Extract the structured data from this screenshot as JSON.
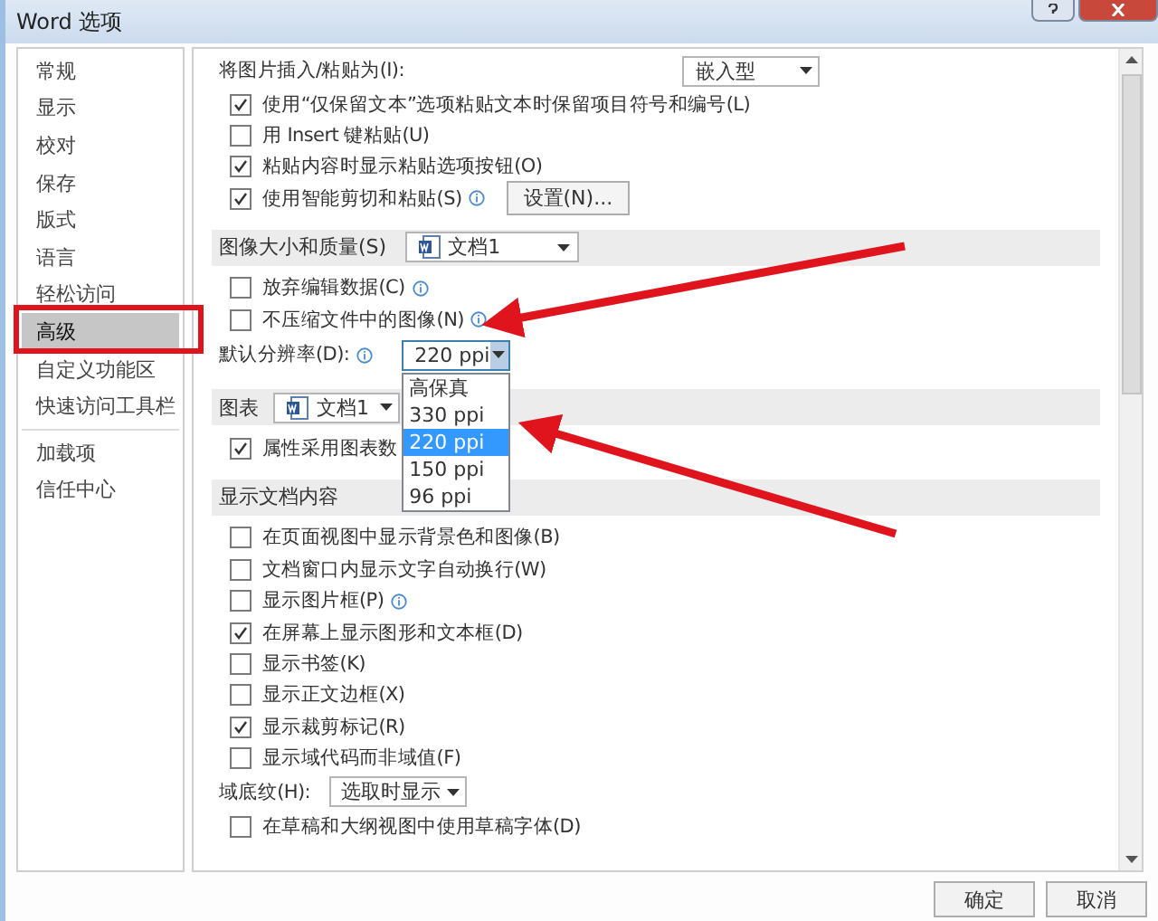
{
  "window": {
    "title": "Word 选项"
  },
  "sidebar": {
    "groups": [
      {
        "items": [
          {
            "label": "常规",
            "selected": false
          },
          {
            "label": "显示",
            "selected": false
          },
          {
            "label": "校对",
            "selected": false
          },
          {
            "label": "保存",
            "selected": false
          },
          {
            "label": "版式",
            "selected": false
          },
          {
            "label": "语言",
            "selected": false
          },
          {
            "label": "轻松访问",
            "selected": false
          },
          {
            "label": "高级",
            "selected": true
          },
          {
            "label": "自定义功能区",
            "selected": false
          },
          {
            "label": "快速访问工具栏",
            "selected": false
          }
        ]
      },
      {
        "items": [
          {
            "label": "加载项",
            "selected": false
          },
          {
            "label": "信任中心",
            "selected": false
          }
        ]
      }
    ]
  },
  "sections": [
    {
      "rows": [
        {
          "kind": "select",
          "label": "将图片插入/粘贴为(I):",
          "value": "嵌入型"
        },
        {
          "kind": "checkbox",
          "label": "使用“仅保留文本”选项粘贴文本时保留项目符号和编号(L)",
          "checked": true
        },
        {
          "kind": "checkbox",
          "label": "用 Insert 键粘贴(U)",
          "checked": false
        },
        {
          "kind": "checkbox",
          "label": "粘贴内容时显示粘贴选项按钮(O)",
          "checked": true
        },
        {
          "kind": "checkbox",
          "label": "使用智能剪切和粘贴(S)",
          "checked": true,
          "info": true,
          "button": "设置(N)..."
        }
      ]
    },
    {
      "title": "图像大小和质量(S)",
      "document": "文档1",
      "rows": [
        {
          "kind": "checkbox",
          "label": "放弃编辑数据(C)",
          "checked": false,
          "info": true
        },
        {
          "kind": "checkbox",
          "label": "不压缩文件中的图像(N)",
          "checked": false,
          "info": true
        },
        {
          "kind": "combo",
          "label": "默认分辨率(D):",
          "info": true,
          "value": "220 ppi",
          "open": true,
          "options": [
            {
              "label": "高保真",
              "selected": false
            },
            {
              "label": "330 ppi",
              "selected": false
            },
            {
              "label": "220 ppi",
              "selected": true
            },
            {
              "label": "150 ppi",
              "selected": false
            },
            {
              "label": "96 ppi",
              "selected": false
            }
          ]
        }
      ]
    },
    {
      "title": "图表",
      "document": "文档1",
      "rows": [
        {
          "kind": "checkbox",
          "label": "属性采用图表数",
          "checked": true
        }
      ]
    },
    {
      "title": "显示文档内容",
      "rows": [
        {
          "kind": "checkbox",
          "label": "在页面视图中显示背景色和图像(B)",
          "checked": false
        },
        {
          "kind": "checkbox",
          "label": "文档窗口内显示文字自动换行(W)",
          "checked": false
        },
        {
          "kind": "checkbox",
          "label": "显示图片框(P)",
          "checked": false,
          "info": true
        },
        {
          "kind": "checkbox",
          "label": "在屏幕上显示图形和文本框(D)",
          "checked": true
        },
        {
          "kind": "checkbox",
          "label": "显示书签(K)",
          "checked": false
        },
        {
          "kind": "checkbox",
          "label": "显示正文边框(X)",
          "checked": false
        },
        {
          "kind": "checkbox",
          "label": "显示裁剪标记(R)",
          "checked": true
        },
        {
          "kind": "checkbox",
          "label": "显示域代码而非域值(F)",
          "checked": false
        },
        {
          "kind": "select",
          "label": "域底纹(H):",
          "value": "选取时显示"
        },
        {
          "kind": "checkbox",
          "label": "在草稿和大纲视图中使用草稿字体(D)",
          "checked": false
        }
      ]
    }
  ],
  "buttons": [
    "确定",
    "取消"
  ]
}
